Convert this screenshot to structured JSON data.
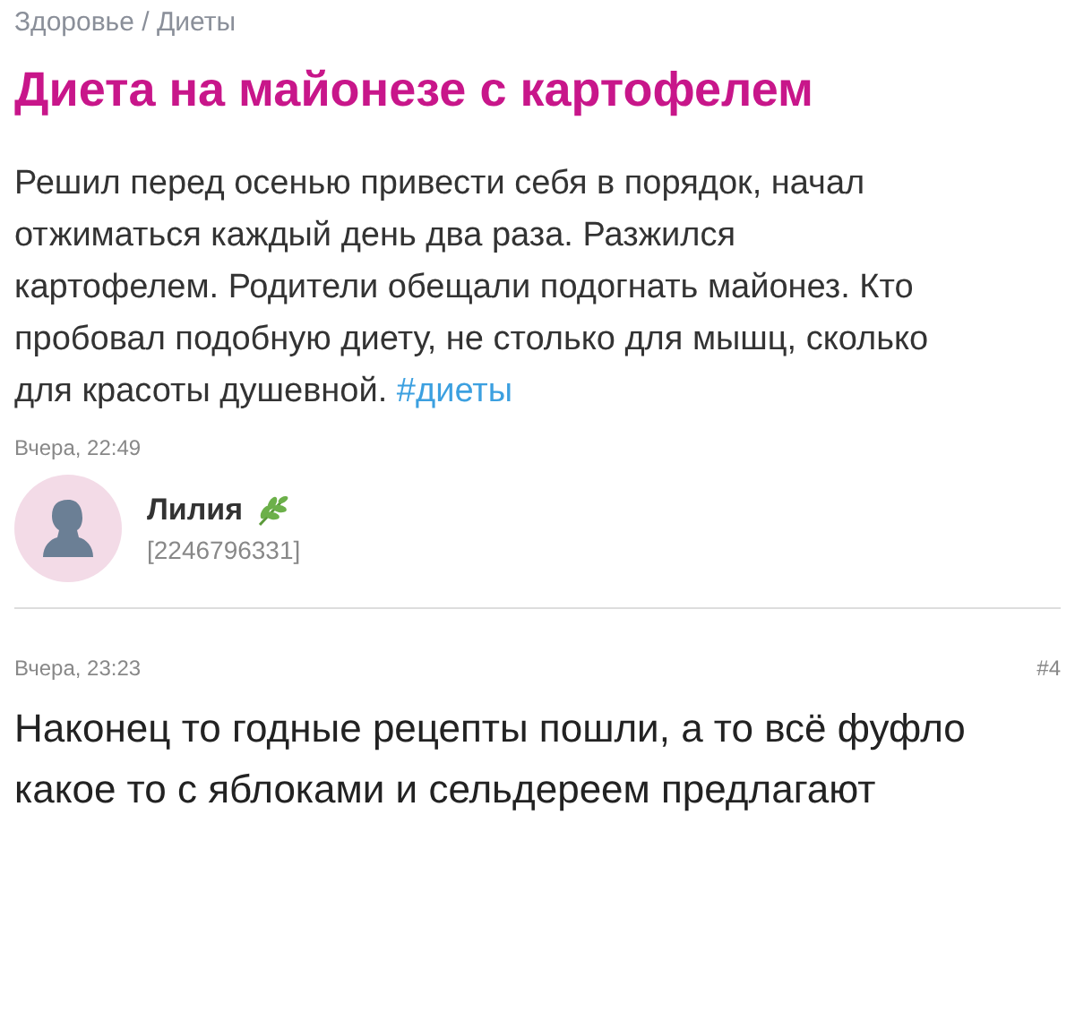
{
  "breadcrumb": "Здоровье / Диеты",
  "title": "Диета на майонезе с картофелем",
  "post": {
    "text": "Решил перед осенью привести себя в порядок, начал отжиматься каждый день два раза. Разжился картофелем. Родители обещали подогнать майонез. Кто пробовал подобную диету, не столько для мышц, сколько для красоты душевной.",
    "hashtag": "#диеты",
    "time": "Вчера, 22:49"
  },
  "author": {
    "name": "Лилия",
    "id": "[2246796331]"
  },
  "comment": {
    "time": "Вчера, 23:23",
    "number": "#4",
    "text": "Наконец то годные рецепты пошли, а то всё фуфло какое то с яблоками и сельдереем предлагают"
  }
}
